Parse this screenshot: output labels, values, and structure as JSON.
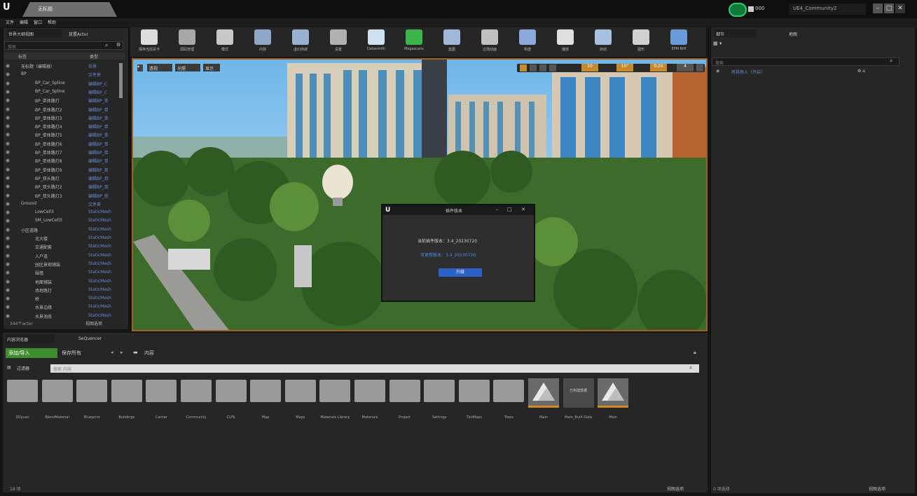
{
  "titlebar": {
    "logo": "U",
    "doc_tab": "无标题",
    "status_text": "000",
    "project": "UE4_Community2"
  },
  "menu": [
    "文件",
    "编辑",
    "窗口",
    "帮助"
  ],
  "outliner": {
    "tabs": [
      "世界大纲视图",
      "放置Actor"
    ],
    "search_placeholder": "搜索",
    "col_label": "标签",
    "col_type": "类型",
    "rows": [
      {
        "label": "无标题（编辑器）",
        "type": "世界"
      },
      {
        "label": "BP",
        "type": "文件夹"
      },
      {
        "label": "BP_Car_Spline",
        "type": "编辑BP_C"
      },
      {
        "label": "BP_Car_Spline",
        "type": "编辑BP_C"
      },
      {
        "label": "BP_单体路灯",
        "type": "编辑BP_单"
      },
      {
        "label": "BP_单体路灯2",
        "type": "编辑BP_单"
      },
      {
        "label": "BP_单体路灯3",
        "type": "编辑BP_单"
      },
      {
        "label": "BP_单体路灯4",
        "type": "编辑BP_单"
      },
      {
        "label": "BP_单体路灯5",
        "type": "编辑BP_单"
      },
      {
        "label": "BP_单体路灯6",
        "type": "编辑BP_单"
      },
      {
        "label": "BP_单体路灯7",
        "type": "编辑BP_单"
      },
      {
        "label": "BP_单体路灯8",
        "type": "编辑BP_单"
      },
      {
        "label": "BP_单体路灯9",
        "type": "编辑BP_单"
      },
      {
        "label": "BP_双头路灯",
        "type": "编辑BP_双"
      },
      {
        "label": "BP_双头路灯2",
        "type": "编辑BP_双"
      },
      {
        "label": "BP_双头路灯3",
        "type": "编辑BP_双"
      },
      {
        "label": "Ground",
        "type": "文件夹"
      },
      {
        "label": "LowCell3",
        "type": "StaticMesh"
      },
      {
        "label": "SM_LowCell3",
        "type": "StaticMesh"
      },
      {
        "label": "小区道路",
        "type": "StaticMesh"
      },
      {
        "label": "北大楼",
        "type": "StaticMesh"
      },
      {
        "label": "交通配套",
        "type": "StaticMesh"
      },
      {
        "label": "入户道",
        "type": "StaticMesh"
      },
      {
        "label": "园区景观铺装",
        "type": "StaticMesh"
      },
      {
        "label": "围墙",
        "type": "StaticMesh"
      },
      {
        "label": "地面铺装",
        "type": "StaticMesh"
      },
      {
        "label": "场地路灯",
        "type": "StaticMesh"
      },
      {
        "label": "桥",
        "type": "StaticMesh"
      },
      {
        "label": "水景边缘",
        "type": "StaticMesh"
      },
      {
        "label": "水景池底",
        "type": "StaticMesh"
      }
    ],
    "actor_count": "344个actor",
    "view_options": "视图选项"
  },
  "toolbar": [
    {
      "label": "保存当前关卡",
      "color": "#dcdcdc"
    },
    {
      "label": "源码管理",
      "color": "#a8a8a8"
    },
    {
      "label": "模式",
      "color": "#c8c8c8"
    },
    {
      "label": "内容",
      "color": "#8fa6c6"
    },
    {
      "label": "虚幻商城",
      "color": "#9ab0d0"
    },
    {
      "label": "设置",
      "color": "#b0b0b0"
    },
    {
      "label": "Datasmith",
      "color": "#cfe0f0"
    },
    {
      "label": "Megascans",
      "color": "#3bb54a"
    },
    {
      "label": "蓝图",
      "color": "#a0b8d8"
    },
    {
      "label": "过场动画",
      "color": "#c0c0c0"
    },
    {
      "label": "构建",
      "color": "#8aa8d8"
    },
    {
      "label": "播放",
      "color": "#e0e0e0"
    },
    {
      "label": "启动",
      "color": "#a8c0e0"
    },
    {
      "label": "图形",
      "color": "#d0d0d0"
    },
    {
      "label": "EPM RHI",
      "color": "#6a9ad8"
    }
  ],
  "viewport": {
    "btn_perspective": "透视",
    "btn_lit": "光照",
    "btn_show": "显示",
    "snap_value": "10",
    "rot_value": "10°",
    "scale_value": "0.25",
    "cam_speed": "4"
  },
  "dialog": {
    "title": "插件版本",
    "line1": "当前插件版本：3.4_20230720",
    "line2": "可更新版本：3.4_20230720",
    "button": "升级"
  },
  "content": {
    "tabs": [
      "内容浏览器",
      "SeQuencer"
    ],
    "add_button": "添加/导入",
    "save_all": "保存所有",
    "path": "内容",
    "filter": "过滤器",
    "search_placeholder": "搜索 内容",
    "assets": [
      {
        "name": "3Dyuan",
        "kind": "folder"
      },
      {
        "name": "BlendMaterial",
        "kind": "folder"
      },
      {
        "name": "Blueprint",
        "kind": "folder"
      },
      {
        "name": "Buildings",
        "kind": "folder"
      },
      {
        "name": "Carrier",
        "kind": "folder"
      },
      {
        "name": "Community",
        "kind": "folder"
      },
      {
        "name": "CUTs",
        "kind": "folder"
      },
      {
        "name": "Map",
        "kind": "folder"
      },
      {
        "name": "Maps",
        "kind": "folder"
      },
      {
        "name": "Materials Library",
        "kind": "folder"
      },
      {
        "name": "Materials",
        "kind": "folder"
      },
      {
        "name": "Project",
        "kind": "folder"
      },
      {
        "name": "Settings",
        "kind": "folder"
      },
      {
        "name": "TimMaps",
        "kind": "folder"
      },
      {
        "name": "Trees",
        "kind": "folder"
      },
      {
        "name": "Main",
        "kind": "map"
      },
      {
        "name": "Main_Built Data",
        "kind": "built"
      },
      {
        "name": "Main",
        "kind": "map"
      }
    ],
    "built_caption": "已构建数据",
    "item_count": "18 项",
    "view_options": "视图选项"
  },
  "details": {
    "tabs": [
      "细节",
      "地图"
    ],
    "search_placeholder": "搜索",
    "row_label": "将其拖入（开启）",
    "item_count": "0 项选择",
    "view_options": "视图选项"
  }
}
